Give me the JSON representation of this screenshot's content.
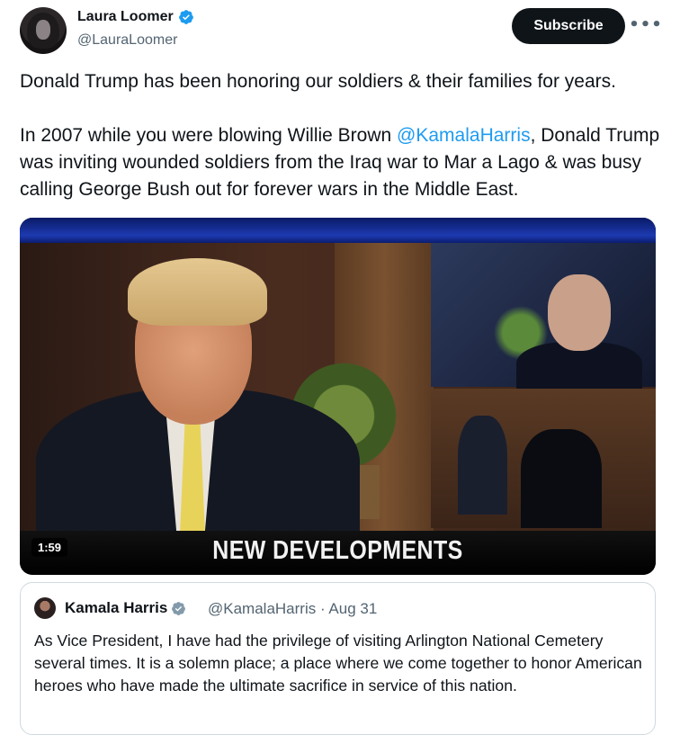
{
  "author": {
    "name": "Laura Loomer",
    "handle": "@LauraLoomer"
  },
  "actions": {
    "subscribe_label": "Subscribe",
    "more_label": "•••"
  },
  "tweet": {
    "paragraph1": "Donald Trump has been honoring our soldiers & their families for years.",
    "paragraph2_before": "In 2007 while you were blowing Willie Brown ",
    "paragraph2_mention": "@KamalaHarris",
    "paragraph2_after": ", Donald Trump was inviting wounded soldiers from the Iraq war to Mar a Lago & was busy calling George Bush out for forever wars in the Middle East."
  },
  "video": {
    "headline": "NEW DEVELOPMENTS",
    "duration": "1:59"
  },
  "quoted": {
    "name": "Kamala Harris",
    "handle_date": "@KamalaHarris · Aug 31",
    "text": "As Vice President, I have had the privilege of visiting Arlington National Cemetery several times. It is a solemn place; a place where we come together to honor American heroes who have made the ultimate sacrifice in service of this nation."
  },
  "colors": {
    "verified": "#1d9bf0",
    "mention": "#1d9bf0",
    "secondary_text": "#536471",
    "button_bg": "#0f1419"
  }
}
